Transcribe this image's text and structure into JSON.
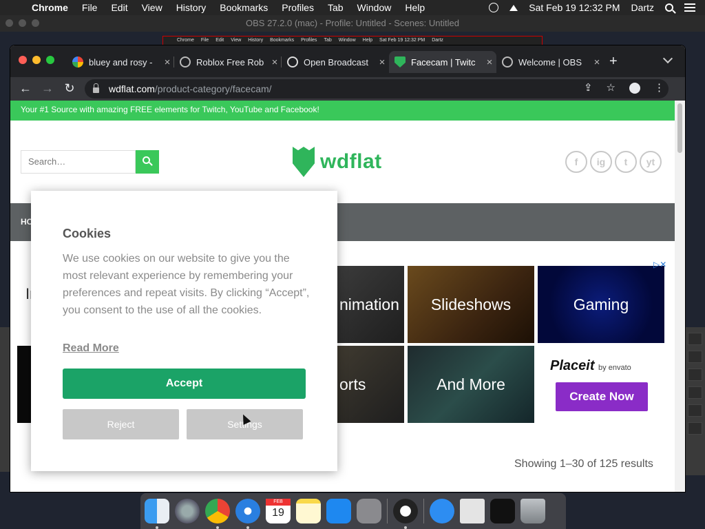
{
  "menubar": {
    "app_name": "Chrome",
    "items": [
      "File",
      "Edit",
      "View",
      "History",
      "Bookmarks",
      "Profiles",
      "Tab",
      "Window",
      "Help"
    ],
    "datetime": "Sat Feb 19  12:32 PM",
    "user": "Dartz"
  },
  "obs": {
    "title": "OBS 27.2.0 (mac) - Profile: Untitled - Scenes: Untitled"
  },
  "preview": {
    "text": [
      "Chrome",
      "File",
      "Edit",
      "View",
      "History",
      "Bookmarks",
      "Profiles",
      "Tab",
      "Window",
      "Help",
      "Sat Feb 19  12:32 PM",
      "Dartz"
    ]
  },
  "tabs": [
    {
      "title": "bluey and rosy -",
      "icon": "google-icon",
      "active": false
    },
    {
      "title": "Roblox Free Rob",
      "icon": "globe-icon",
      "active": false
    },
    {
      "title": "Open Broadcast",
      "icon": "obs-icon",
      "active": false
    },
    {
      "title": "Facecam | Twitc",
      "icon": "wdflat-icon",
      "active": true
    },
    {
      "title": "Welcome | OBS",
      "icon": "globe-icon",
      "active": false
    }
  ],
  "address": {
    "domain": "wdflat.com",
    "path": "/product-category/facecam/"
  },
  "site": {
    "topbar": "Your #1 Source with amazing FREE elements for Twitch, YouTube and Facebook!",
    "search_placeholder": "Search…",
    "logo": "wdflat",
    "social": [
      "f",
      "ig",
      "t",
      "yt"
    ],
    "nav_partial": "HO",
    "left_partial": "In",
    "showing": "Showing 1–30 of 125 results"
  },
  "tiles": [
    {
      "label": "nimation"
    },
    {
      "label": "Slideshows"
    },
    {
      "label": "Gaming"
    },
    {
      "label": "orts"
    },
    {
      "label": "And More"
    }
  ],
  "ad": {
    "brand": "Placeit",
    "by": "by envato",
    "cta": "Create Now"
  },
  "cookie": {
    "title": "Cookies",
    "body": "We use cookies on our website to give you the most relevant experience by remembering your preferences and repeat visits. By clicking “Accept”, you consent to the use of all the cookies.",
    "read_more": "Read More",
    "accept": "Accept",
    "reject": "Reject",
    "settings": "Settings"
  },
  "dock": [
    "Finder",
    "Launchpad",
    "Chrome",
    "Safari",
    "Calendar",
    "Notes",
    "App Store",
    "System Preferences",
    "OBS",
    "Downloads",
    "Document",
    "Screen",
    "Trash"
  ],
  "calendar": {
    "month": "FEB",
    "day": "19"
  },
  "colors": {
    "brand_green": "#3ac85a",
    "accept_green": "#1ba367",
    "cta_purple": "#8a2cc7"
  }
}
